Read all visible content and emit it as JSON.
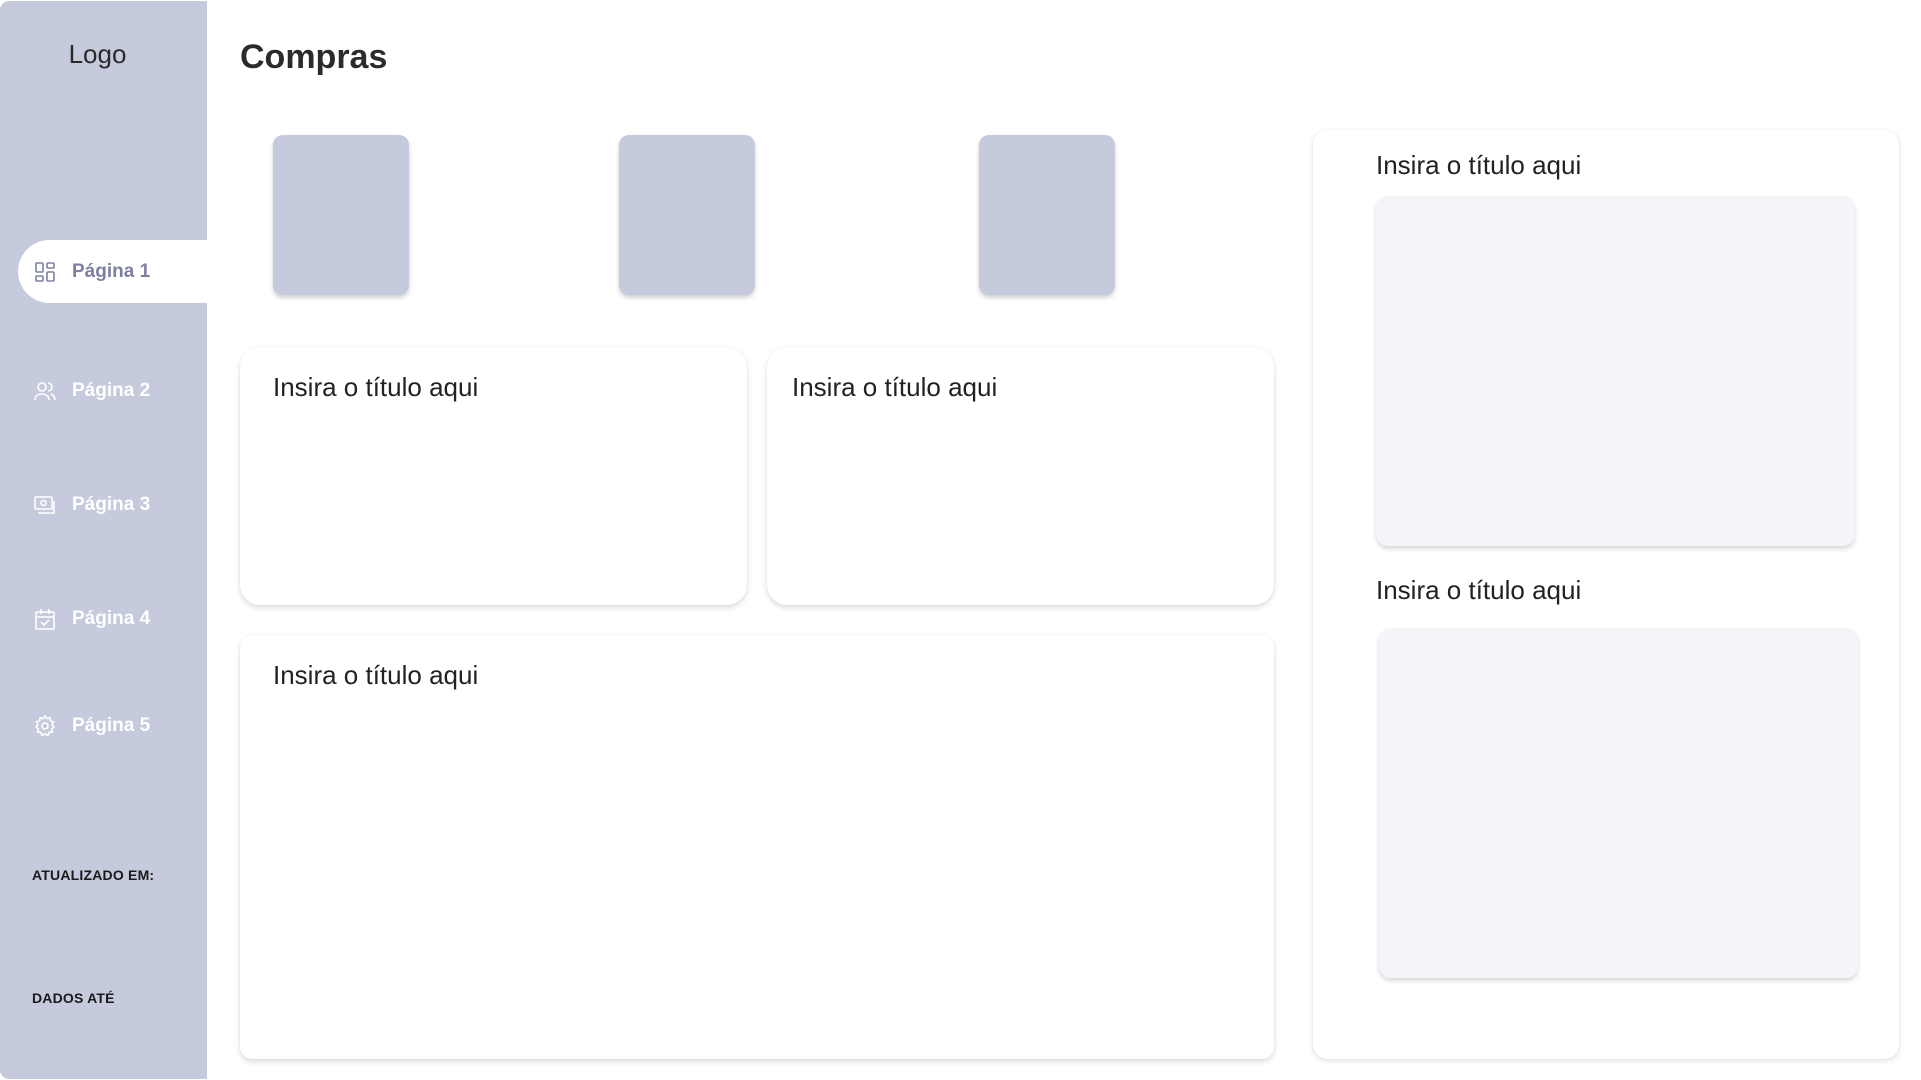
{
  "sidebar": {
    "logo": "Logo",
    "items": [
      {
        "label": "Página 1",
        "icon": "dashboard-icon",
        "active": true
      },
      {
        "label": "Página 2",
        "icon": "users-icon",
        "active": false
      },
      {
        "label": "Página 3",
        "icon": "money-icon",
        "active": false
      },
      {
        "label": "Página 4",
        "icon": "calendar-check-icon",
        "active": false
      },
      {
        "label": "Página 5",
        "icon": "gear-icon",
        "active": false
      }
    ],
    "updated_label": "ATUALIZADO EM:",
    "data_until_label": "DADOS ATÉ"
  },
  "main": {
    "title": "Compras",
    "cards": [
      {
        "title": "Insira o título aqui"
      },
      {
        "title": "Insira o título aqui"
      },
      {
        "title": "Insira o título aqui"
      }
    ],
    "right_panel": [
      {
        "title": "Insira o título aqui"
      },
      {
        "title": "Insira o título aqui"
      }
    ]
  },
  "colors": {
    "sidebar_bg": "#c5cadd",
    "active_text": "#7d80a0",
    "panel_fill": "#f4f5f9"
  }
}
